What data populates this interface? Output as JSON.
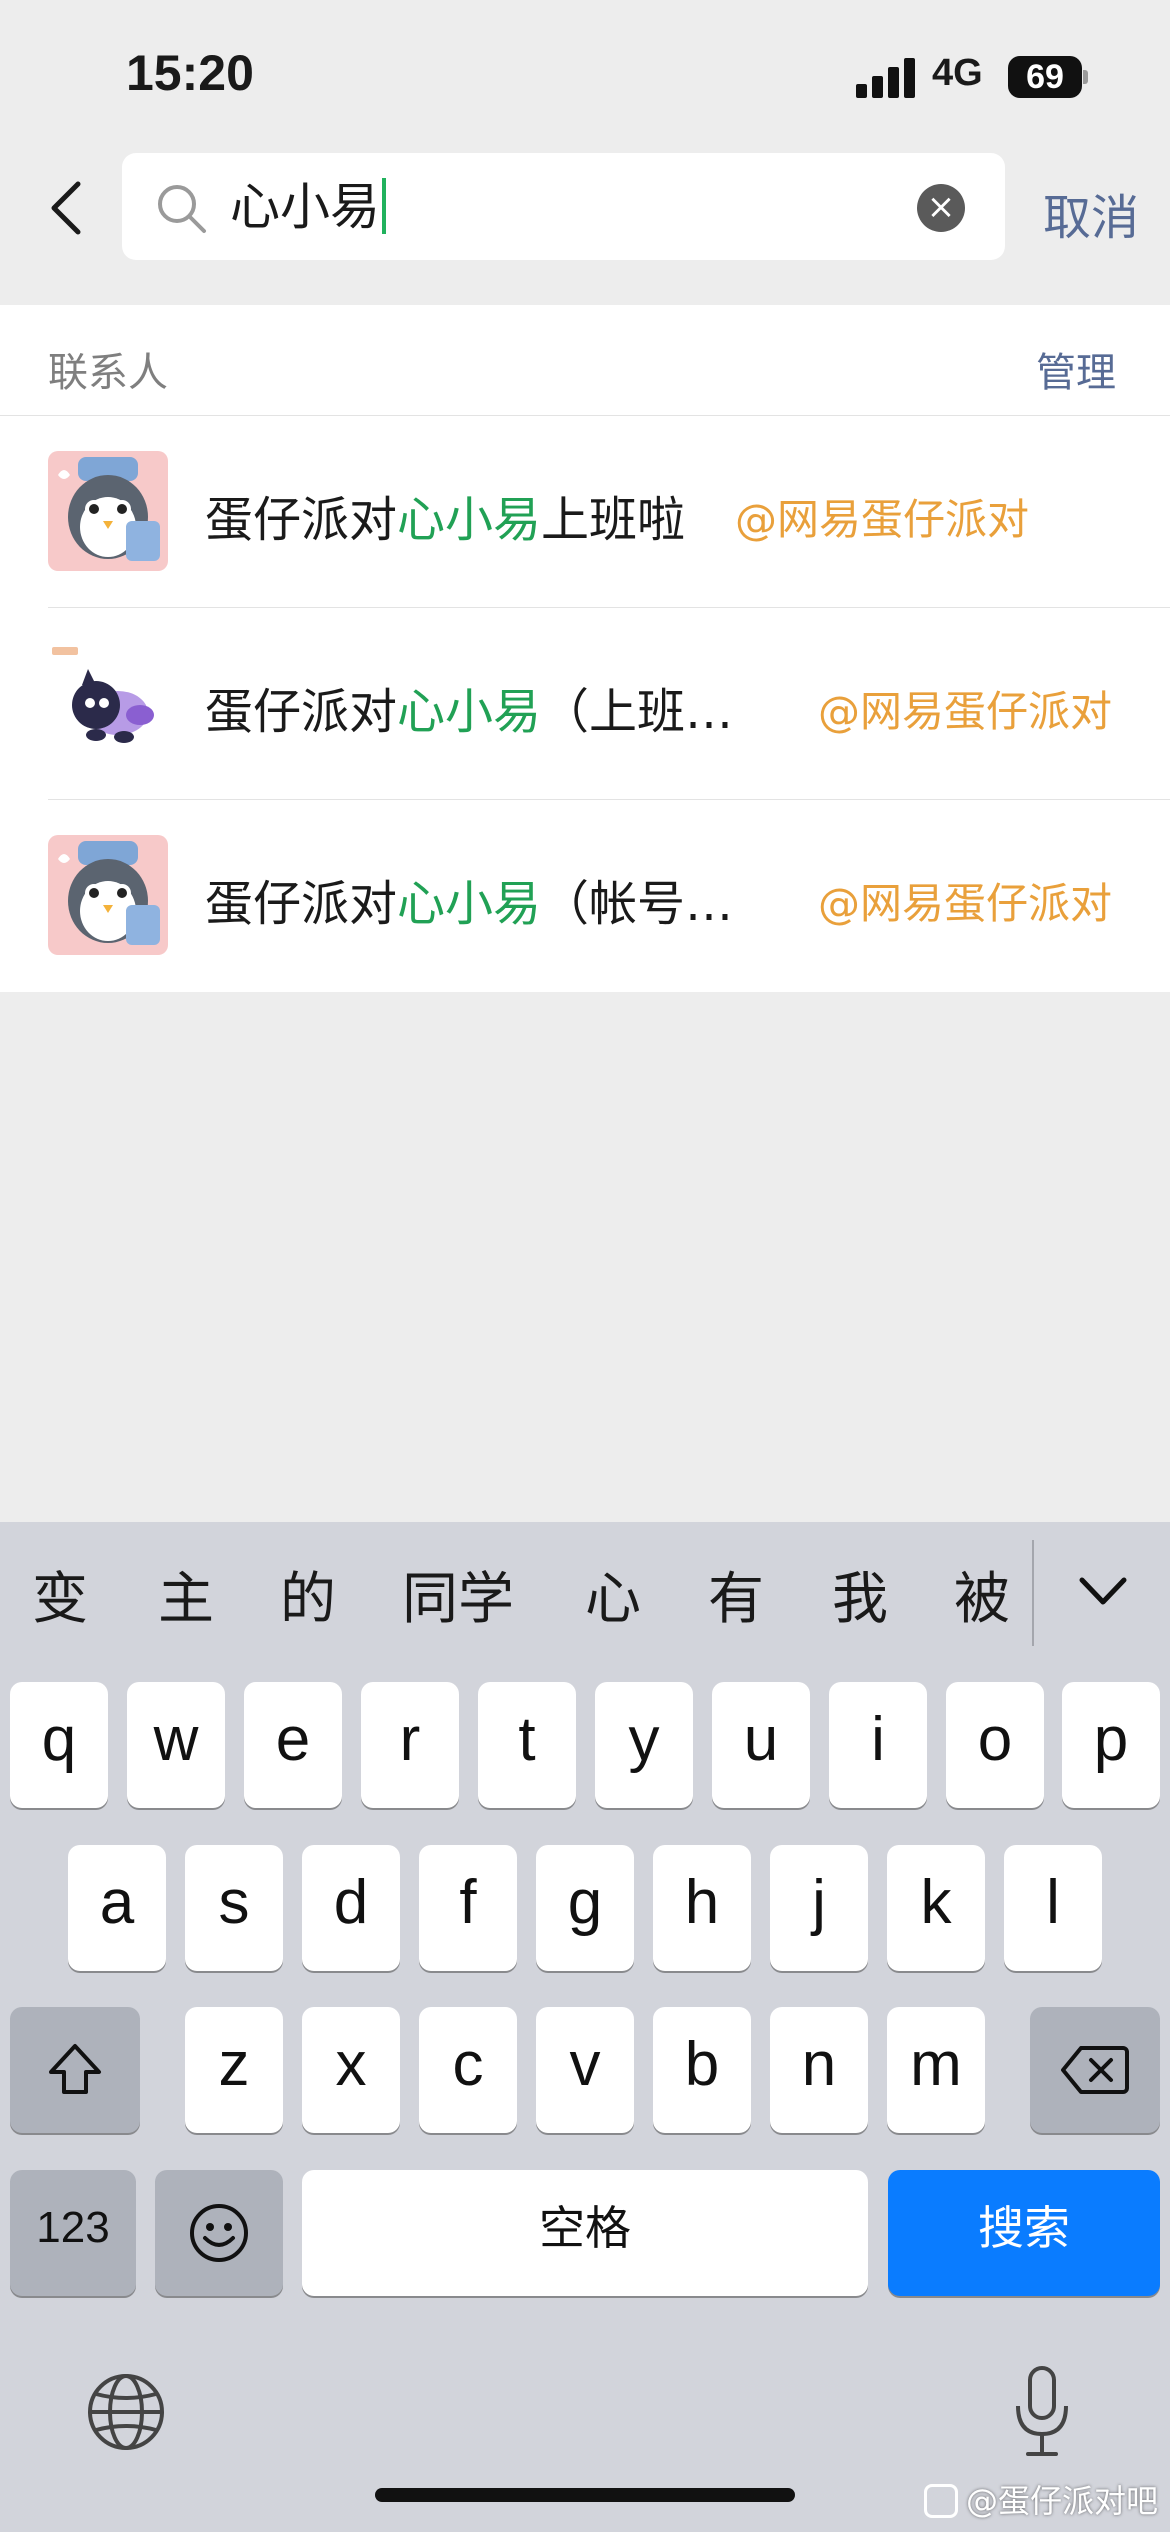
{
  "status_bar": {
    "time": "15:20",
    "network": "4G",
    "battery": "69"
  },
  "search": {
    "query": "心小易",
    "cancel_label": "取消",
    "clear_icon": "clear-icon",
    "search_icon": "search-icon"
  },
  "section": {
    "title": "联系人",
    "manage_label": "管理"
  },
  "results": [
    {
      "prefix": "蛋仔派对",
      "highlight": "心小易",
      "suffix": "上班啦",
      "tag": "@网易蛋仔派对",
      "avatar": "penguin-avatar"
    },
    {
      "prefix": "蛋仔派对",
      "highlight": "心小易",
      "suffix": "（上班…",
      "tag": "@网易蛋仔派对",
      "avatar": "purple-pet-avatar"
    },
    {
      "prefix": "蛋仔派对",
      "highlight": "心小易",
      "suffix": "（帐号…",
      "tag": "@网易蛋仔派对",
      "avatar": "penguin-avatar"
    }
  ],
  "keyboard": {
    "candidates": [
      "变",
      "主",
      "的",
      "同学",
      "心",
      "有",
      "我",
      "被"
    ],
    "row1": [
      "q",
      "w",
      "e",
      "r",
      "t",
      "y",
      "u",
      "i",
      "o",
      "p"
    ],
    "row2": [
      "a",
      "s",
      "d",
      "f",
      "g",
      "h",
      "j",
      "k",
      "l"
    ],
    "row3": [
      "z",
      "x",
      "c",
      "v",
      "b",
      "n",
      "m"
    ],
    "numbers_label": "123",
    "space_label": "空格",
    "search_label": "搜索"
  },
  "watermark": "@蛋仔派对吧",
  "colors": {
    "accent_green": "#21a155",
    "link_blue": "#576b95",
    "tag_orange": "#e9a03b",
    "search_key_blue": "#0a7cff"
  }
}
